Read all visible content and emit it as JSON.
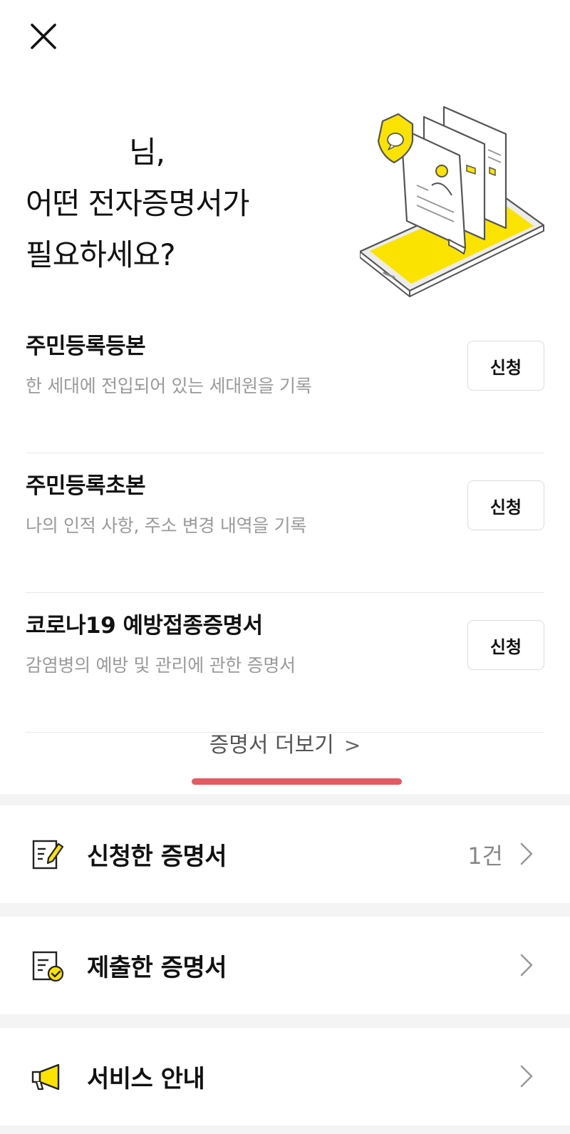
{
  "header": {
    "close_icon": "close-icon"
  },
  "hero": {
    "line1": "님,",
    "line2_highlight": "어떤 전자증명서",
    "line2_rest": "가",
    "line3": "필요하세요?"
  },
  "documents": [
    {
      "title": "주민등록등본",
      "desc": "한 세대에 전입되어 있는 세대원을 기록",
      "button": "신청"
    },
    {
      "title": "주민등록초본",
      "desc": "나의 인적 사항, 주소 변경 내역을 기록",
      "button": "신청"
    },
    {
      "title": "코로나19 예방접종증명서",
      "desc": "감염병의 예방 및 관리에 관한 증명서",
      "button": "신청"
    }
  ],
  "more_link": {
    "label": "증명서 더보기",
    "chevron": ">"
  },
  "menu": [
    {
      "label": "신청한 증명서",
      "count": "1건",
      "icon": "edit-document-icon"
    },
    {
      "label": "제출한 증명서",
      "count": "",
      "icon": "submitted-document-icon"
    },
    {
      "label": "서비스 안내",
      "count": "",
      "icon": "megaphone-icon"
    }
  ],
  "colors": {
    "accent_yellow": "#fbe300",
    "underline_red": "#e35a63",
    "divider": "#e9e9e9",
    "section_gap": "#f4f4f4"
  }
}
